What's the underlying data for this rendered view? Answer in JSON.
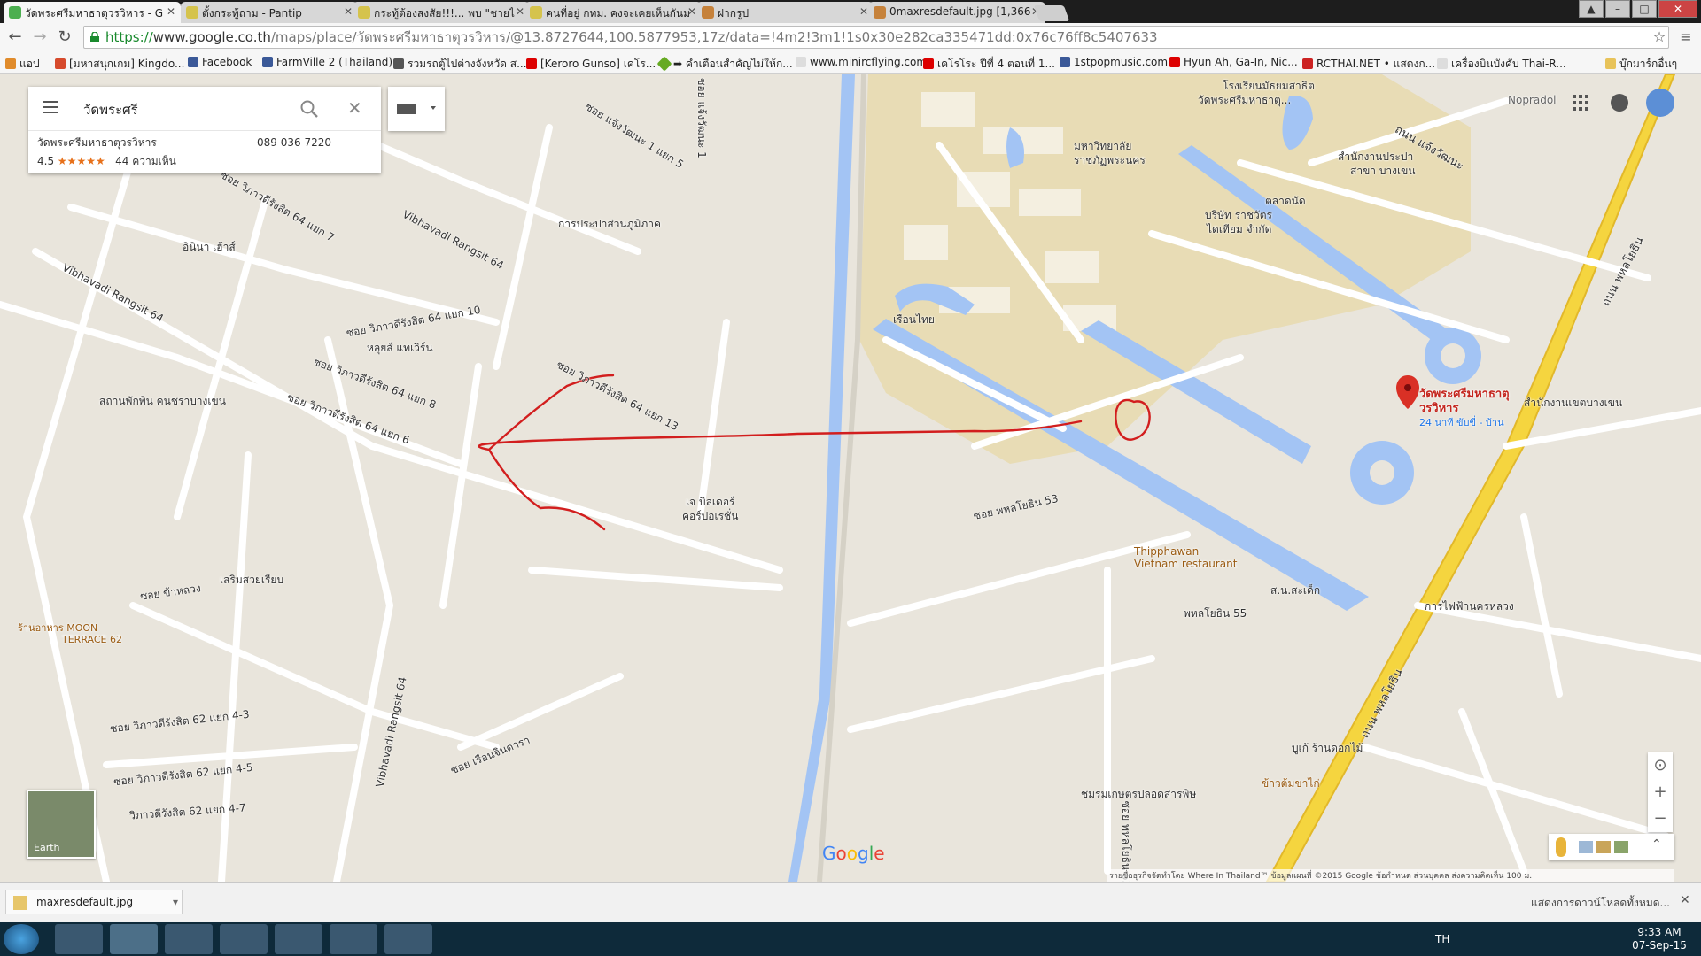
{
  "tabs": [
    {
      "title": "วัดพระศรีมหาธาตุวรวิหาร - G",
      "active": true,
      "favicon": "google-maps-icon"
    },
    {
      "title": "ตั้งกระทู้ถาม - Pantip",
      "active": false,
      "favicon": "pantip-icon"
    },
    {
      "title": "กระทู้ต้องสงสัย!!!... พบ \"ชายไ",
      "active": false,
      "favicon": "pantip-icon"
    },
    {
      "title": "คนที่อยู่ กทม. คงจะเคยเห็นกันม",
      "active": false,
      "favicon": "pantip-icon"
    },
    {
      "title": "ฝากรูป",
      "active": false,
      "favicon": "page-icon"
    },
    {
      "title": "0maxresdefault.jpg [1,366",
      "active": false,
      "favicon": "image-icon"
    }
  ],
  "address_bar": {
    "scheme": "https://",
    "host": "www.google.co.th",
    "path": "/maps/place/วัดพระศรีมหาธาตุวรวิหาร/@13.8727644,100.5877953,17z/data=!4m2!3m1!1s0x30e282ca335471dd:0x76c76ff8c5407633"
  },
  "bookmarks": [
    {
      "label": "แอป",
      "icon": "apps-icon"
    },
    {
      "label": "[มหาสนุกเกม] Kingdo...",
      "icon": "game-icon"
    },
    {
      "label": "Facebook",
      "icon": "facebook-icon"
    },
    {
      "label": "FarmVille 2 (Thailand)",
      "icon": "facebook-icon"
    },
    {
      "label": "รวมรถตู้ไปต่างจังหวัด ส...",
      "icon": "van-icon"
    },
    {
      "label": "[Keroro Gunso] เคโร...",
      "icon": "youtube-icon"
    },
    {
      "label": "➡ คำเตือนสำคัญไม่ให้ก...",
      "icon": "diamond-icon"
    },
    {
      "label": "www.minircflying.com",
      "icon": "page-icon"
    },
    {
      "label": "เคโรโระ ปีที่ 4 ตอนที่ 1...",
      "icon": "youtube-icon"
    },
    {
      "label": "1stpopmusic.com",
      "icon": "facebook-icon"
    },
    {
      "label": "Hyun Ah, Ga-In, Nic...",
      "icon": "youtube-icon"
    },
    {
      "label": "RCTHAI.NET • แสดงก...",
      "icon": "rc-icon"
    },
    {
      "label": "เครื่องบินบังคับ Thai-R...",
      "icon": "page-icon"
    },
    {
      "label": "บุ๊กมาร์กอื่นๆ",
      "icon": "folder-icon"
    }
  ],
  "search": {
    "query": "วัดพระศรี",
    "place_name": "วัดพระศรีมหาธาตุวรวิหาร",
    "phone": "089 036 7220",
    "rating": "4.5",
    "stars": "★★★★★",
    "reviews": "44 ความเห็น"
  },
  "map_labels": {
    "pin_title_1": "วัดพระศรีมหาธาตุ",
    "pin_title_2": "วรวิหาร",
    "pin_subtitle": "24 นาที ขับขี่ - บ้าน",
    "school": "โรงเรียนมัธยมสาธิต",
    "school2": "วัดพระศรีมหาธาตุ...",
    "nopradol": "Nopradol",
    "univ1": "มหาวิทยาลัย",
    "univ2": "ราชภัฏพระนคร",
    "water1": "สำนักงานประปา",
    "water2": "สาขา บางเขน",
    "market": "ตลาดนัด",
    "company1": "บริษัท ราชวัตร",
    "company2": "ไดเทียม จำกัด",
    "ruenthai": "เรือนไทย",
    "district": "สำนักงานเขตบางเขน",
    "thippawan1": "Thipphawan",
    "thippawan2": "Vietnam restaurant",
    "phahon55": "พหลโยธิน 55",
    "phahon53": "ซอย พหลโยธิน 53",
    "ngam_wong": "ถนน แจ้งวัฒนะ",
    "phahon_rd": "ถนน พหลโยธิน",
    "phahon_rd2": "ถนน พหลโยธิน",
    "electric": "การไฟฟ้านครหลวง",
    "flower": "บูเก้ ร้านดอกไม้",
    "food": "ข้าวต้มขาไก่",
    "fishery": "ชมรมเกษตรปลอดสารพิษ",
    "jbuilder1": "เจ บิลเดอร์",
    "jbuilder2": "คอร์ปอเรชั่น",
    "water_authority": "การประปาส่วนภูมิภาค",
    "inna": "อินินา เฮ้าส์",
    "hotel": "หลุยส์ แทเวิร์น",
    "vibha64": "Vibhavadi Rangsit 64",
    "vibha64b": "Vibhavadi Rangsit 64",
    "vibha64c": "Vibhavadi Rangsit 64",
    "s64_7": "ซอย วิภาวดีรังสิต 64 แยก 7",
    "s64_10": "ซอย วิภาวดีรังสิต 64 แยก 10",
    "s64_8": "ซอย วิภาวดีรังสิต 64 แยก 8",
    "s64_6": "ซอย วิภาวดีรังสิต 64 แยก 6",
    "s64_13": "ซอย วิภาวดีรังสิต 64 แยก 13",
    "s64_1": "ซอย แจ้งวัฒนะ 1 แยก 5",
    "s_khaluang": "ซอย ข้าหลวง",
    "kindergarten": "สถานพักพิน คนชราบางเขน",
    "moon1": "ร้านอาหาร MOON",
    "moon2": "TERRACE 62",
    "semsuay": "เสริมสวยเรียบ",
    "s62_4_3": "ซอย วิภาวดีรังสิต 62 แยก 4-3",
    "s62_4_5": "ซอย วิภาวดีรังสิต 62 แยก 4-5",
    "s62_4_7": "วิภาวดีรังสิต 62 แยก 4-7",
    "ruen_jinda": "ซอย เรือนจินดารา",
    "phahon53b": "ซอย พหลโยธิน 53",
    "sanamek": "ส.น.สะเด็ก",
    "chan": "ซอย",
    "s1": "ซอย แจ้งวัฒนะ 1"
  },
  "map_controls": {
    "earth_label": "Earth",
    "google_logo": "Google",
    "attribution": "รายชื่อธุรกิจจัดทำโดย Where In Thailand™   ข้อมูลแผนที่ ©2015 Google   ข้อกำหนด   ส่วนบุคคล   ส่งความคิดเห็น   100 ม.",
    "zoom_in": "+",
    "zoom_out": "−"
  },
  "download_bar": {
    "file": "maxresdefault.jpg",
    "show_all": "แสดงการดาวน์โหลดทั้งหมด..."
  },
  "taskbar": {
    "lang": "TH",
    "time": "9:33 AM",
    "date": "07-Sep-15"
  },
  "colors": {
    "water": "#a3c4f4",
    "road": "#ffffff",
    "highway": "#f5d53f",
    "temple_area": "#e8dcb5",
    "annotation": "#d21e1e",
    "pin": "#d93025"
  }
}
